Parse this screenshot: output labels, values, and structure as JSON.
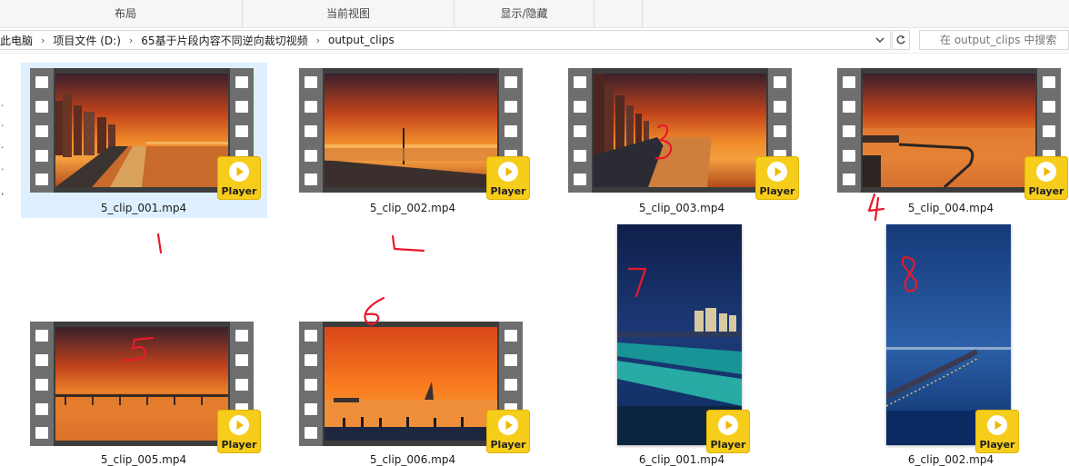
{
  "ribbon": {
    "groups": [
      "布局",
      "当前视图",
      "显示/隐藏"
    ]
  },
  "address": {
    "crumbs": [
      "此电脑",
      "项目文件 (D:)",
      "65基于片段内容不同逆向裁切视频",
      "output_clips"
    ]
  },
  "search": {
    "placeholder": "在 output_clips 中搜索"
  },
  "player_label": "Player",
  "files": [
    {
      "name": "5_clip_001.mp4",
      "selected": true
    },
    {
      "name": "5_clip_002.mp4"
    },
    {
      "name": "5_clip_003.mp4"
    },
    {
      "name": "5_clip_004.mp4"
    },
    {
      "name": "5_clip_005.mp4"
    },
    {
      "name": "5_clip_006.mp4"
    },
    {
      "name": "6_clip_001.mp4"
    },
    {
      "name": "6_clip_002.mp4"
    }
  ],
  "annotations": [
    "1",
    "2",
    "3",
    "4",
    "5",
    "6",
    "7",
    "8"
  ],
  "colors": {
    "accent_yellow": "#f7cd1b",
    "selection": "#cce8ff",
    "annotation_red": "#e8192c"
  }
}
